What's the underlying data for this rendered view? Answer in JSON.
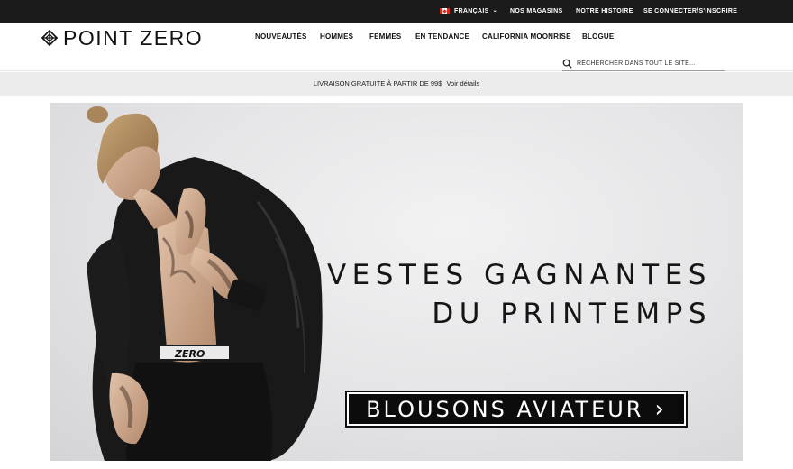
{
  "topbar": {
    "language": "FRANÇAIS",
    "language_flag": "canada-flag-icon",
    "stores": "NOS MAGASINS",
    "story": "NOTRE HISTOIRE",
    "login": "SE CONNECTER/S'INSCRIRE"
  },
  "header": {
    "logo": "POINT ZERO",
    "nav": [
      "NOUVEAUTÉS",
      "HOMMES",
      "FEMMES",
      "EN TENDANCE",
      "CALIFORNIA MOONRISE",
      "BLOGUE"
    ],
    "search_placeholder": "RECHERCHER DANS TOUT LE SITE..."
  },
  "promo": {
    "text": "LIVRAISON GRATUITE À PARTIR DE 99$",
    "link": "Voir détails"
  },
  "hero": {
    "headline_line1": "VESTES GAGNANTES",
    "headline_line2": "DU PRINTEMPS",
    "cta": "BLOUSONS AVIATEUR",
    "cta_icon": "chevron-right-icon",
    "waistband_text": "ZERO"
  },
  "colors": {
    "topbar_bg": "#1b1b1b",
    "promo_bg": "#ececec",
    "cta_bg": "#0c0c0c",
    "hero_bg": "#e4e4e6"
  }
}
